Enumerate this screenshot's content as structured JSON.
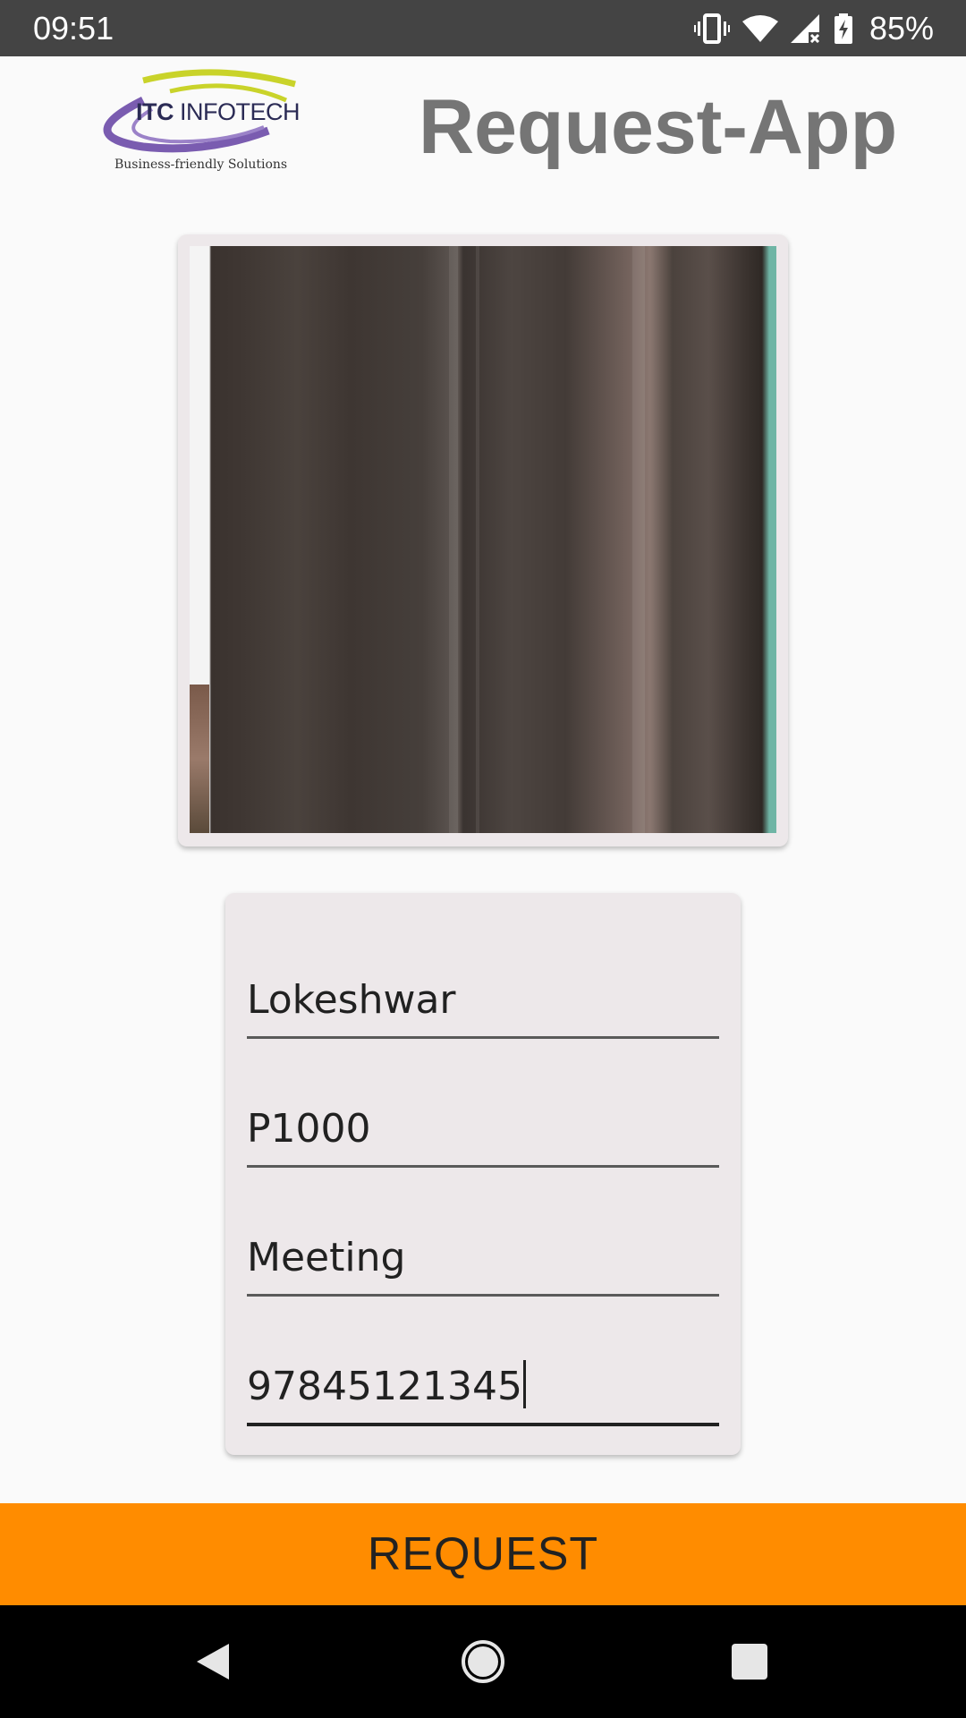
{
  "status_bar": {
    "time": "09:51",
    "battery_percent": "85%",
    "icons": [
      "vibrate-icon",
      "wifi-icon",
      "cellular-no-signal-icon",
      "battery-charging-icon"
    ]
  },
  "header": {
    "logo": {
      "brand_bold": "ITC",
      "brand_rest": " INFOTECH",
      "tagline": "Business-friendly Solutions"
    },
    "title": "Request-App"
  },
  "photo_card": {
    "icon": "captured-photo"
  },
  "form": {
    "fields": [
      {
        "value": "Lokeshwar"
      },
      {
        "value": "P1000"
      },
      {
        "value": "Meeting"
      },
      {
        "value": "97845121345"
      }
    ]
  },
  "request_button": {
    "label": "REQUEST",
    "color": "#ff8c00"
  },
  "nav_bar": {
    "buttons": [
      "back-icon",
      "home-icon",
      "recents-icon"
    ]
  }
}
